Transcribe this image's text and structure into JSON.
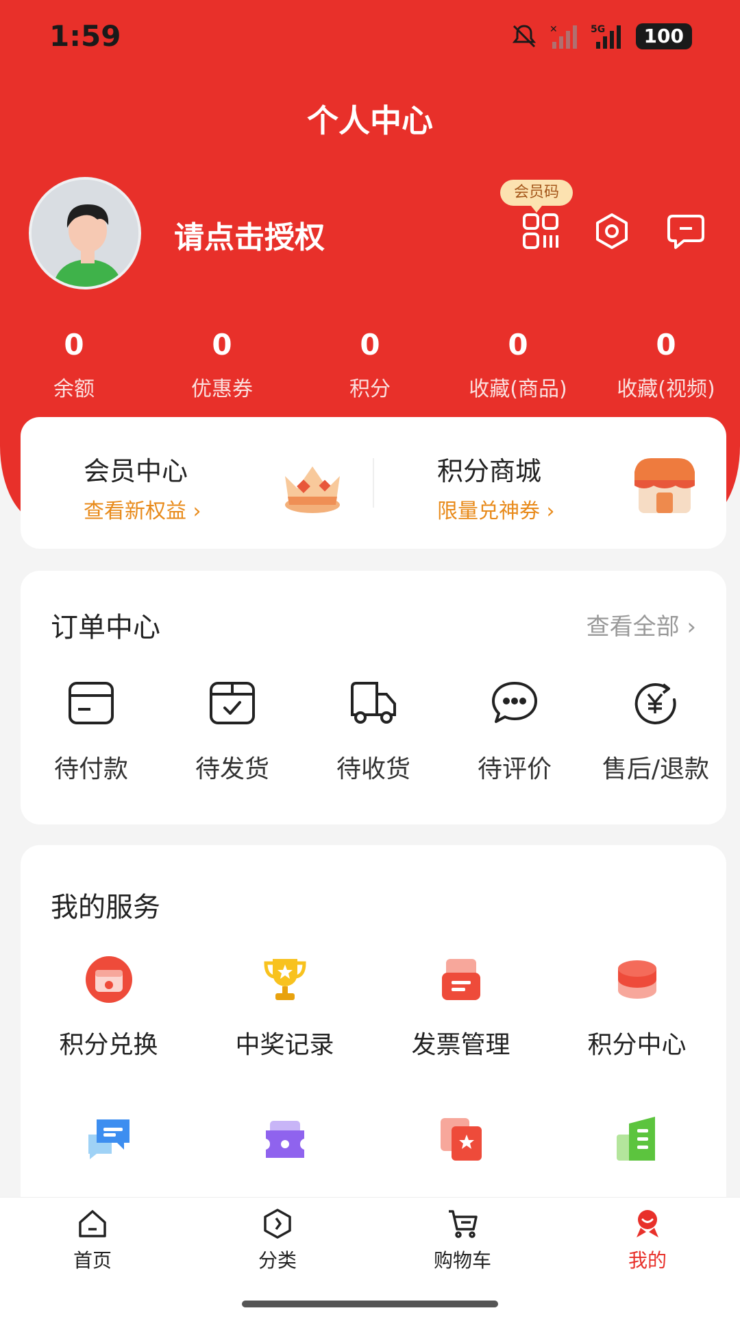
{
  "status": {
    "time": "1:59",
    "network": "5G",
    "battery": "100"
  },
  "header": {
    "title": "个人中心",
    "username": "请点击授权",
    "member_code_label": "会员码"
  },
  "stats": [
    {
      "value": "0",
      "label": "余额"
    },
    {
      "value": "0",
      "label": "优惠券"
    },
    {
      "value": "0",
      "label": "积分"
    },
    {
      "value": "0",
      "label": "收藏(商品)"
    },
    {
      "value": "0",
      "label": "收藏(视频)"
    }
  ],
  "promos": [
    {
      "title": "会员中心",
      "subtitle": "查看新权益 ›"
    },
    {
      "title": "积分商城",
      "subtitle": "限量兑神券 ›"
    }
  ],
  "orders": {
    "title": "订单中心",
    "see_all": "查看全部 ›",
    "items": [
      {
        "label": "待付款",
        "icon": "wallet-icon"
      },
      {
        "label": "待发货",
        "icon": "box-check-icon"
      },
      {
        "label": "待收货",
        "icon": "truck-icon"
      },
      {
        "label": "待评价",
        "icon": "chat-bubble-icon"
      },
      {
        "label": "售后/退款",
        "icon": "yen-refund-icon"
      }
    ]
  },
  "services": {
    "title": "我的服务",
    "items": [
      {
        "label": "积分兑换",
        "icon": "points-exchange-icon"
      },
      {
        "label": "中奖记录",
        "icon": "trophy-icon"
      },
      {
        "label": "发票管理",
        "icon": "invoice-icon"
      },
      {
        "label": "积分中心",
        "icon": "coins-stack-icon"
      },
      {
        "label": "",
        "icon": "chat-window-icon"
      },
      {
        "label": "",
        "icon": "ticket-icon"
      },
      {
        "label": "",
        "icon": "favorites-icon"
      },
      {
        "label": "",
        "icon": "building-icon"
      }
    ]
  },
  "tabbar": [
    {
      "label": "首页",
      "icon": "home-icon"
    },
    {
      "label": "分类",
      "icon": "category-icon"
    },
    {
      "label": "购物车",
      "icon": "cart-icon"
    },
    {
      "label": "我的",
      "icon": "profile-icon"
    }
  ],
  "colors": {
    "brand_red": "#e8302a",
    "accent_orange": "#e88a1a"
  }
}
